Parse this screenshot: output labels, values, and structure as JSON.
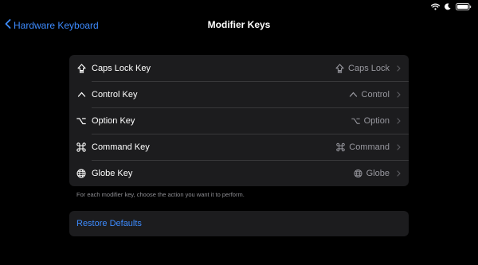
{
  "nav": {
    "back_label": "Hardware Keyboard",
    "title": "Modifier Keys"
  },
  "keys": [
    {
      "label": "Caps Lock Key",
      "value": "Caps Lock",
      "icon": "caps-lock-icon"
    },
    {
      "label": "Control Key",
      "value": "Control",
      "icon": "control-icon"
    },
    {
      "label": "Option Key",
      "value": "Option",
      "icon": "option-icon"
    },
    {
      "label": "Command Key",
      "value": "Command",
      "icon": "command-icon"
    },
    {
      "label": "Globe Key",
      "value": "Globe",
      "icon": "globe-icon"
    }
  ],
  "footnote": "For each modifier key, choose the action you want it to perform.",
  "restore_label": "Restore Defaults",
  "colors": {
    "background": "#000000",
    "group": "#1c1c1e",
    "accent": "#3d8bff",
    "secondary_text": "#98989f"
  }
}
